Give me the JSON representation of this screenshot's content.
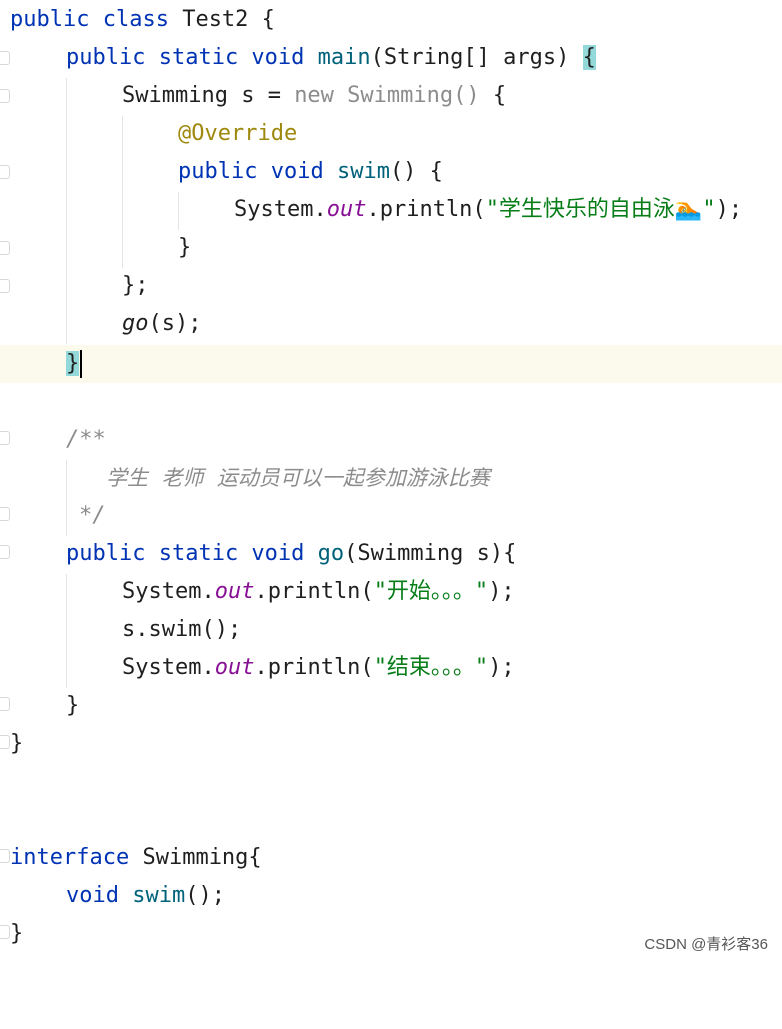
{
  "editor": {
    "lines": {
      "l1": {
        "kw1": "public class",
        "rest": " Test2 {"
      },
      "l2": {
        "kw1": "public static void",
        "fn": "main",
        "rest": "(String[] args) ",
        "brace": "{"
      },
      "l3": {
        "pre": "Swimming s = ",
        "anon": "new Swimming()",
        "rest": " {"
      },
      "l4": {
        "ann": "@Override"
      },
      "l5": {
        "kw1": "public void",
        "fn": "swim",
        "rest": "() {"
      },
      "l6": {
        "pre": "System.",
        "field": "out",
        "mid": ".println(",
        "str": "\"学生快乐的自由泳🏊\"",
        "rest": ");"
      },
      "l7": {
        "text": "}"
      },
      "l8": {
        "text": "};"
      },
      "l9": {
        "call": "go",
        "rest": "(s);"
      },
      "l10": {
        "brace": "}"
      },
      "l12": {
        "text": "/**"
      },
      "l13": {
        "text": "学生  老师  运动员可以一起参加游泳比赛"
      },
      "l14": {
        "text": "*/"
      },
      "l15": {
        "kw1": "public static void",
        "fn": "go",
        "rest": "(Swimming s){"
      },
      "l16": {
        "pre": "System.",
        "field": "out",
        "mid": ".println(",
        "str": "\"开始。。。\"",
        "rest": ");"
      },
      "l17": {
        "text": "s.swim();"
      },
      "l18": {
        "pre": "System.",
        "field": "out",
        "mid": ".println(",
        "str": "\"结束。。。\"",
        "rest": ");"
      },
      "l19": {
        "text": "}"
      },
      "l20": {
        "text": "}"
      },
      "l23": {
        "kw1": "interface",
        "rest": " Swimming{"
      },
      "l24": {
        "kw1": "void",
        "fn": "swim",
        "rest": "();"
      },
      "l25": {
        "text": "}"
      }
    }
  },
  "watermark": "CSDN @青衫客36",
  "colors": {
    "keyword": "#0033b3",
    "method": "#00627a",
    "field": "#871094",
    "string": "#067d17",
    "annotation": "#9e880d",
    "comment": "#8c8c8c",
    "current_line": "#fcfaed",
    "brace_match": "#93d9d9"
  }
}
